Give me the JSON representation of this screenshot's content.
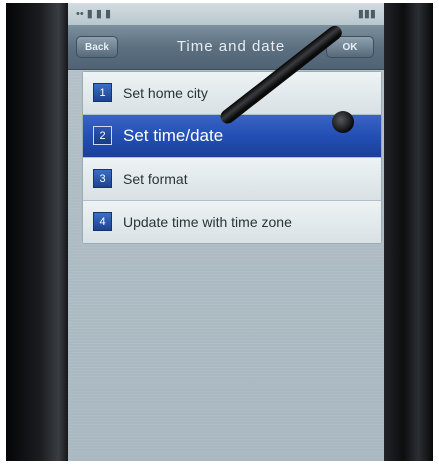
{
  "status_bar": {
    "left": "••  ▮ ▮ ▮",
    "right": "▮▮▮"
  },
  "header": {
    "back_label": "Back",
    "title": "Time and date",
    "ok_label": "OK"
  },
  "menu": {
    "items": [
      {
        "num": "1",
        "label": "Set home city",
        "selected": false
      },
      {
        "num": "2",
        "label": "Set time/date",
        "selected": true
      },
      {
        "num": "3",
        "label": "Set format",
        "selected": false
      },
      {
        "num": "4",
        "label": "Update time with time zone",
        "selected": false
      }
    ]
  },
  "colors": {
    "selected_row": "#234fb4",
    "title_bar": "#5c7081",
    "screen_bg": "#aebcc4"
  }
}
